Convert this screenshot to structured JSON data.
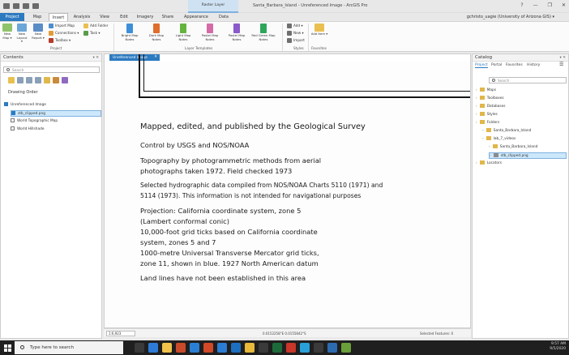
{
  "window": {
    "context_tab": "Raster Layer",
    "title": "Santa_Barbara_Island - Unreferenced Image - ArcGIS Pro",
    "controls": [
      "?",
      "—",
      "❐",
      "✕"
    ],
    "user": "gchristo_uagie (University of Arizona GIS) ▾"
  },
  "ribbon": {
    "tabs": [
      "Project",
      "Map",
      "Insert",
      "Analysis",
      "View",
      "Edit",
      "Imagery",
      "Share",
      "Appearance",
      "Data"
    ],
    "active_tab": "Insert",
    "project_group": {
      "label": "Project",
      "new_map": "New Map ▾",
      "new_layout": "New Layout ▾",
      "new_report": "New Report ▾",
      "import_map": "Import Map",
      "connections": "Connections ▾",
      "toolbox": "Toolbox ▾",
      "add_folder": "Add Folder",
      "task": "Task ▾"
    },
    "layer_templates": {
      "label": "Layer Templates",
      "items": [
        {
          "label": "Bright Map Notes",
          "color": "#3f8fd8"
        },
        {
          "label": "Dark Map Notes",
          "color": "#e06d2c"
        },
        {
          "label": "Light Map Notes",
          "color": "#64b33f"
        },
        {
          "label": "Pastel Map Notes",
          "color": "#d46aa8"
        },
        {
          "label": "Pastel Map Notes",
          "color": "#8a5bc9"
        },
        {
          "label": "Red Green Map Notes",
          "color": "#2ea65a"
        }
      ]
    },
    "styles": {
      "label": "Styles",
      "add": "Add ▾",
      "new": "New ▾",
      "import": "Import"
    },
    "favorites": {
      "label": "Favorites",
      "add_item": "Add Item ▾"
    }
  },
  "contents": {
    "title": "Contents",
    "search_placeholder": "Search",
    "drawing_order": "Drawing Order",
    "layers": [
      {
        "label": "Unreferenced Image",
        "checked": true,
        "selected": false
      },
      {
        "label": "stb_clipped.png",
        "checked": true,
        "selected": true
      },
      {
        "label": "World Topographic Map",
        "checked": false,
        "selected": false
      },
      {
        "label": "World Hillshade",
        "checked": false,
        "selected": false
      }
    ]
  },
  "map_view": {
    "tab_label": "Unreferenced Image",
    "text_lines": [
      "Mapped, edited, and published by the Geological Survey",
      "Control by USGS and NOS/NOAA",
      "Topography by photogrammetric methods from aerial",
      "photographs taken 1972.    Field checked 1973",
      "Selected hydrographic data compiled from NOS/NOAA Charts 5110 (1971) and",
      "5114 (1973).    This information is not intended for navigational purposes",
      "Projection: California coordinate system, zone 5",
      " (Lambert conformal conic)",
      "10,000-foot grid ticks based on California coordinate",
      "system, zones 5 and 7",
      "1000-metre Universal Transverse Mercator grid ticks,",
      "zone 11, shown in blue.    1927 North American datum",
      "Land lines have not been established in this area"
    ]
  },
  "status_bar": {
    "scale": "1:6,923",
    "coordinates": "0.0152258°E 0.0155842°S",
    "selected_features": "Selected Features: 0"
  },
  "catalog": {
    "title": "Catalog",
    "tabs": [
      "Project",
      "Portal",
      "Favorites",
      "History"
    ],
    "search_placeholder": "Search",
    "items": [
      {
        "label": "Maps",
        "level": 0
      },
      {
        "label": "Toolboxes",
        "level": 0
      },
      {
        "label": "Databases",
        "level": 0
      },
      {
        "label": "Styles",
        "level": 0
      },
      {
        "label": "Folders",
        "level": 0
      },
      {
        "label": "Santa_Barbara_Island",
        "level": 1
      },
      {
        "label": "lab_7_videos",
        "level": 1
      },
      {
        "label": "Santa_Barbara_Island",
        "level": 2
      },
      {
        "label": "stb_clipped.png",
        "level": 2
      },
      {
        "label": "Locators",
        "level": 0
      }
    ]
  },
  "taskbar": {
    "search_placeholder": "Type here to search",
    "time": "9:57 AM",
    "date": "9/5/2020",
    "icon_colors": [
      "#3a3a3a",
      "#2d7bd6",
      "#f0c24a",
      "#c94a2a",
      "#2a7fd4",
      "#d04a2a",
      "#2b7cd3",
      "#1e6fc0",
      "#e8b93a",
      "#3a3a3a",
      "#1d6b3a",
      "#c9362a",
      "#2aa0d8",
      "#3a3a3a",
      "#2c6bb0",
      "#6a9f3a"
    ]
  }
}
